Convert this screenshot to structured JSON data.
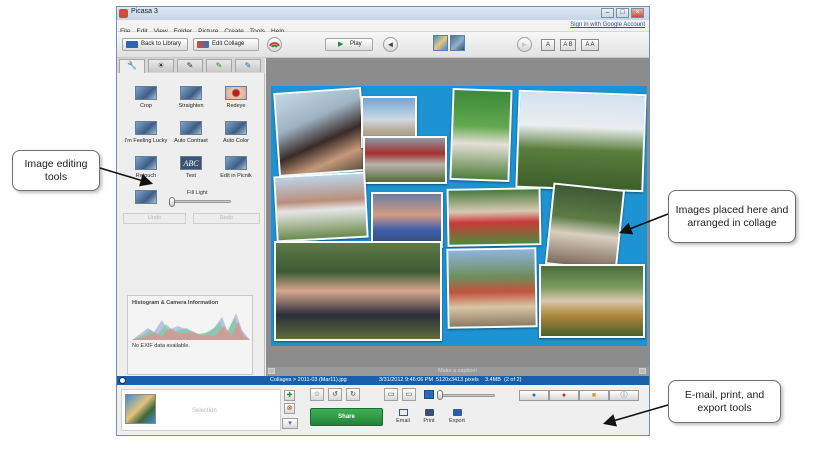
{
  "window": {
    "title": "Picasa 3",
    "controls": {
      "minimize": "–",
      "maximize": "□",
      "close": "×"
    }
  },
  "menu": {
    "items": [
      "File",
      "Edit",
      "View",
      "Folder",
      "Picture",
      "Create",
      "Tools",
      "Help"
    ],
    "signin": "Sign in with Google Account"
  },
  "toolbar": {
    "back_label": "Back to Library",
    "edit_collage_label": "Edit Collage",
    "play_label": "Play",
    "play_icon": "▶",
    "prev_icon": "◄",
    "next_icon": "►",
    "text_buttons": [
      "A",
      "A B",
      "A A"
    ]
  },
  "left_panel": {
    "tab_icons": [
      "wrench-icon",
      "sun-icon",
      "brush-icon",
      "effects-brush-icon",
      "effects-brush-2-icon"
    ],
    "tab_glyphs": [
      "🔧",
      "☀",
      "✎",
      "✎",
      "✎"
    ],
    "tools": [
      "Crop",
      "Straighten",
      "Redeye",
      "I'm Feeling Lucky",
      "Auto Contrast",
      "Auto Color",
      "Retouch",
      "Text",
      "Edit in Picnik"
    ],
    "fill_light_label": "Fill Light",
    "fill_light_level": 0,
    "undo_label": "Undo",
    "redo_label": "Redo",
    "histogram_title": "Histogram & Camera Information",
    "exif_text": "No EXIF data available."
  },
  "canvas": {
    "caption_placeholder": "Make a caption!"
  },
  "status": {
    "path": "Collages > 2011-03 (Mar11).jpg",
    "date": "3/31/2012 9:46:06 PM",
    "dimensions": "5120x3413 pixels",
    "size": "3.4MB",
    "count": "(2 of 2)"
  },
  "bottom": {
    "selection_label": "Selection",
    "share_label": "Share",
    "actions": [
      "Email",
      "Print",
      "Export"
    ]
  },
  "callouts": {
    "editing_tools": "Image editing tools",
    "images_placed": "Images placed here and arranged in collage",
    "email_print": "E-mail, print, and export tools"
  },
  "colors": {
    "collage_background": "#1d93d3",
    "status_bar": "#1a5faa",
    "share_button": "#2e9a47"
  }
}
